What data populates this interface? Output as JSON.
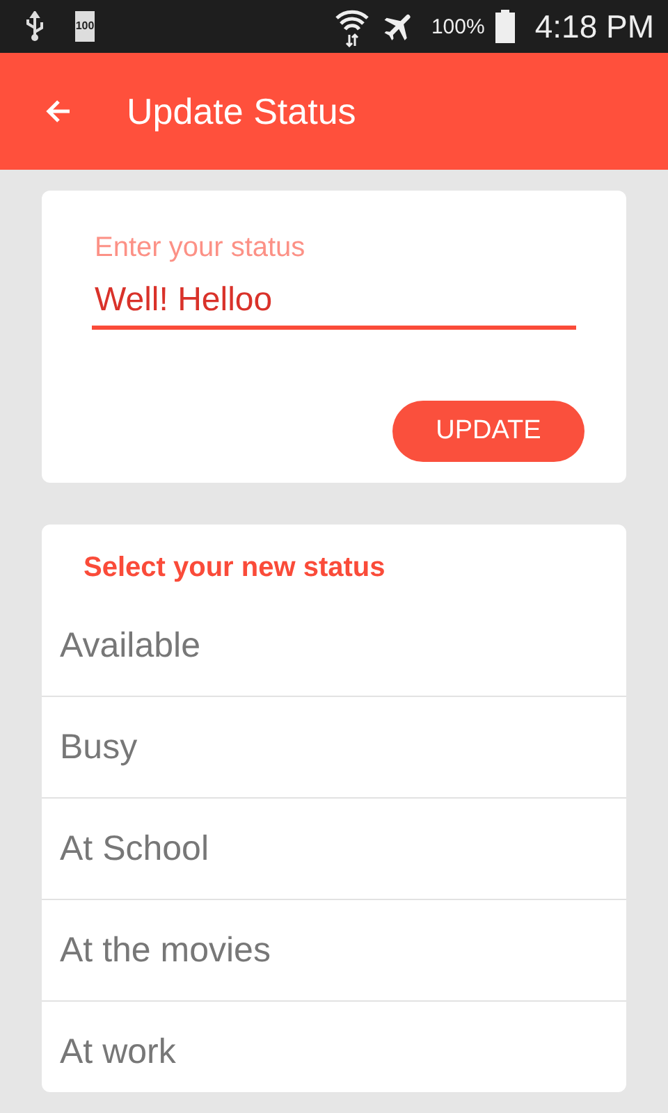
{
  "status_bar": {
    "battery_badge": "100",
    "battery_percent": "100%",
    "time": "4:18 PM"
  },
  "toolbar": {
    "title": "Update Status"
  },
  "status_form": {
    "placeholder": "Enter your status",
    "value": "Well! Helloo",
    "button": "UPDATE"
  },
  "status_list": {
    "heading": "Select your new status",
    "items": [
      {
        "label": "Available"
      },
      {
        "label": "Busy"
      },
      {
        "label": "At School"
      },
      {
        "label": "At the movies"
      },
      {
        "label": "At work"
      }
    ]
  }
}
